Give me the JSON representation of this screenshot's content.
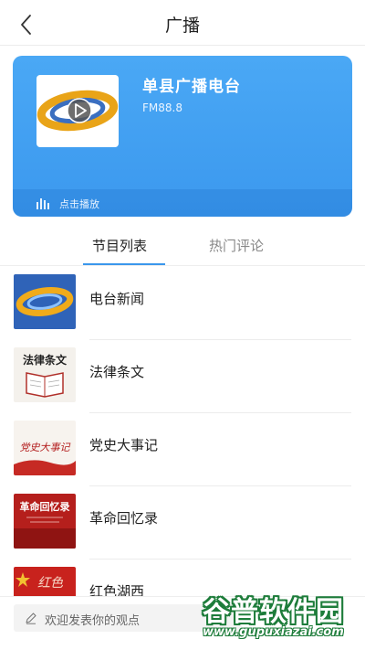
{
  "header": {
    "title": "广播",
    "back_icon": "chevron-left-icon"
  },
  "station": {
    "name": "单县广播电台",
    "frequency": "FM88.8",
    "play_label": "点击播放",
    "play_icon": "audio-bars-icon",
    "card_color": "#4aa8f5"
  },
  "tabs": [
    {
      "label": "节目列表",
      "active": true
    },
    {
      "label": "热门评论",
      "active": false
    }
  ],
  "programs": [
    {
      "title": "电台新闻",
      "thumb_text": ""
    },
    {
      "title": "法律条文",
      "thumb_text": "法律条文"
    },
    {
      "title": "党史大事记",
      "thumb_text": "党史大事记"
    },
    {
      "title": "革命回忆录",
      "thumb_text": "革命回忆录"
    },
    {
      "title": "红色湖西",
      "thumb_text": "红色"
    }
  ],
  "comment": {
    "placeholder": "欢迎发表你的观点",
    "icon": "pencil-icon"
  },
  "watermark": {
    "main": "谷普软件园",
    "url": "www.gupuxiazai.com"
  },
  "colors": {
    "accent": "#3a97ec",
    "active_tab_text": "#222222",
    "inactive_tab_text": "#888888"
  }
}
